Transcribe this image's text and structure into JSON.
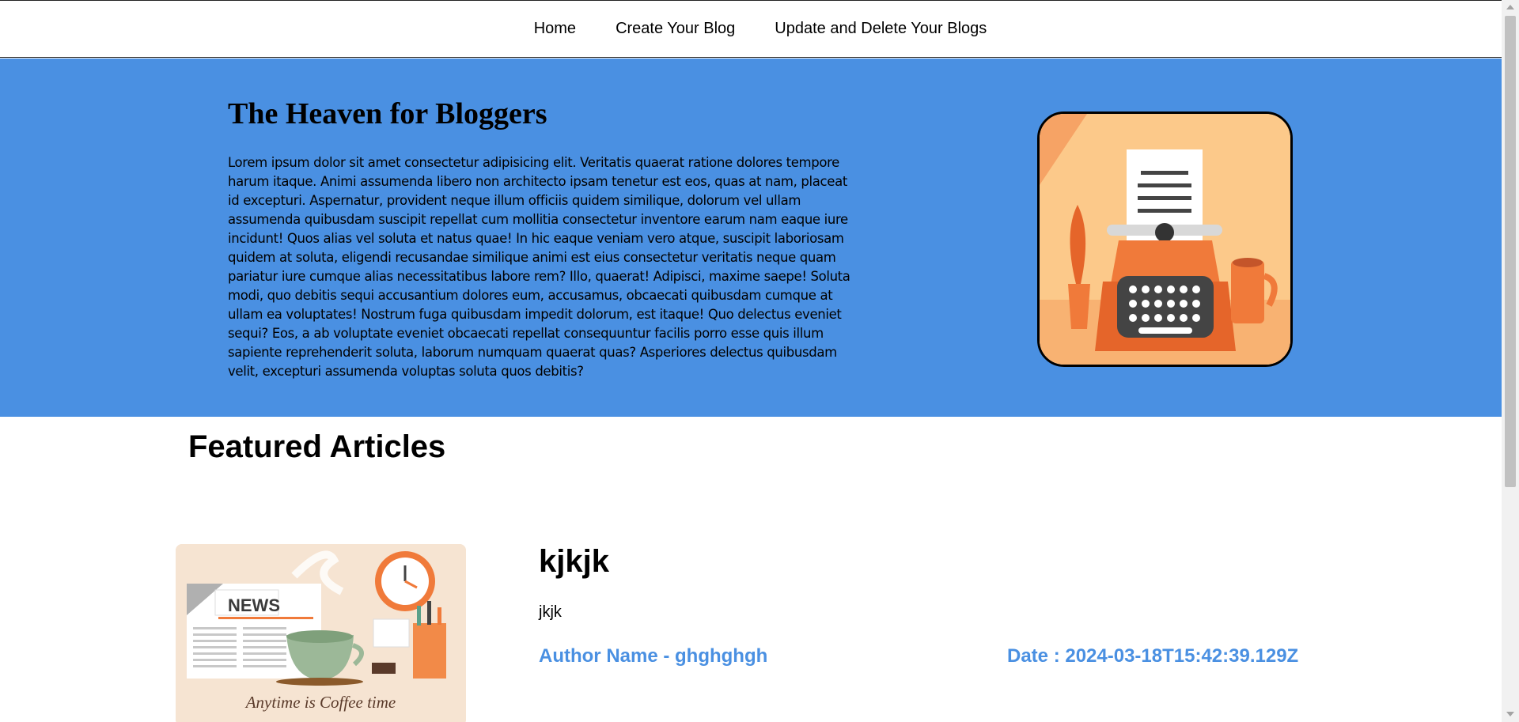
{
  "nav": {
    "items": [
      {
        "label": "Home"
      },
      {
        "label": "Create Your Blog"
      },
      {
        "label": "Update and Delete Your Blogs"
      }
    ]
  },
  "hero": {
    "title": "The Heaven for Bloggers",
    "text": "Lorem ipsum dolor sit amet consectetur adipisicing elit. Veritatis quaerat ratione dolores tempore harum itaque. Animi assumenda libero non architecto ipsam tenetur est eos, quas at nam, placeat id excepturi. Aspernatur, provident neque illum officiis quidem similique, dolorum vel ullam assumenda quibusdam suscipit repellat cum mollitia consectetur inventore earum nam eaque iure incidunt! Quos alias vel soluta et natus quae! In hic eaque veniam vero atque, suscipit laboriosam quidem at soluta, eligendi recusandae similique animi est eius consectetur veritatis neque quam pariatur iure cumque alias necessitatibus labore rem? Illo, quaerat! Adipisci, maxime saepe! Soluta modi, quo debitis sequi accusantium dolores eum, accusamus, obcaecati quibusdam cumque at ullam ea voluptates! Nostrum fuga quibusdam impedit dolorum, est itaque! Quo delectus eveniet sequi? Eos, a ab voluptate eveniet obcaecati repellat consequuntur facilis porro esse quis illum sapiente reprehenderit soluta, laborum numquam quaerat quas? Asperiores delectus quibusdam velit, excepturi assumenda voluptas soluta quos debitis?",
    "image_icon": "typewriter-illustration"
  },
  "featured": {
    "heading": "Featured Articles",
    "articles": [
      {
        "title": "kjkjk",
        "description": "jkjk",
        "author": "Author Name - ghghghgh",
        "date": "Date : 2024-03-18T15:42:39.129Z",
        "image_icon": "news-coffee-illustration",
        "image_badge": "NEWS",
        "image_caption": "Anytime is Coffee time"
      }
    ]
  },
  "colors": {
    "accent": "#4a90e2",
    "illustration_orange": "#f07a3a"
  }
}
